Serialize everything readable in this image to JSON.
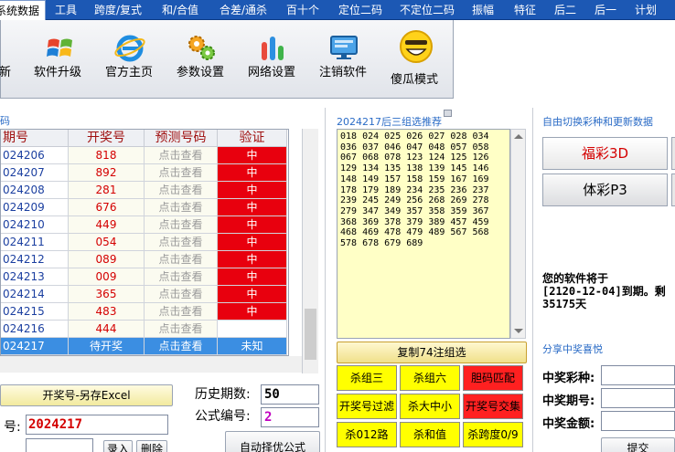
{
  "menu": {
    "items": [
      {
        "label": "系统数据",
        "active": true
      },
      {
        "label": "工具"
      },
      {
        "label": "跨度/复式"
      },
      {
        "label": "和/合值"
      },
      {
        "label": "合差/通杀"
      },
      {
        "label": "百十个"
      },
      {
        "label": "定位二码"
      },
      {
        "label": "不定位二码"
      },
      {
        "label": "振幅"
      },
      {
        "label": "特征"
      },
      {
        "label": "后二"
      },
      {
        "label": "后一"
      },
      {
        "label": "计划"
      }
    ]
  },
  "toolbar": {
    "buttons": [
      {
        "label": "新",
        "icon": "new-icon"
      },
      {
        "label": "软件升级",
        "icon": "windows-logo-icon"
      },
      {
        "label": "官方主页",
        "icon": "ie-browser-icon"
      },
      {
        "label": "参数设置",
        "icon": "gears-icon"
      },
      {
        "label": "网络设置",
        "icon": "bar-chart-icon"
      },
      {
        "label": "注销软件",
        "icon": "monitor-icon"
      },
      {
        "label": "傻瓜模式",
        "icon": "smiley-icon"
      }
    ]
  },
  "left": {
    "panel_header": "码",
    "columns": [
      "期号",
      "开奖号",
      "预测号码",
      "验证"
    ],
    "rows": [
      {
        "issue": "024206",
        "draw": "818",
        "pred": "点击查看",
        "ver": "中"
      },
      {
        "issue": "024207",
        "draw": "892",
        "pred": "点击查看",
        "ver": "中"
      },
      {
        "issue": "024208",
        "draw": "281",
        "pred": "点击查看",
        "ver": "中"
      },
      {
        "issue": "024209",
        "draw": "676",
        "pred": "点击查看",
        "ver": "中"
      },
      {
        "issue": "024210",
        "draw": "449",
        "pred": "点击查看",
        "ver": "中"
      },
      {
        "issue": "024211",
        "draw": "054",
        "pred": "点击查看",
        "ver": "中"
      },
      {
        "issue": "024212",
        "draw": "089",
        "pred": "点击查看",
        "ver": "中"
      },
      {
        "issue": "024213",
        "draw": "009",
        "pred": "点击查看",
        "ver": "中"
      },
      {
        "issue": "024214",
        "draw": "365",
        "pred": "点击查看",
        "ver": "中"
      },
      {
        "issue": "024215",
        "draw": "483",
        "pred": "点击查看",
        "ver": "中"
      },
      {
        "issue": "024216",
        "draw": "444",
        "pred": "点击查看",
        "ver": ""
      },
      {
        "issue": "024217",
        "draw": "待开奖",
        "pred": "点击查看",
        "ver": "未知",
        "selected": true
      }
    ],
    "save_button": "开奖号-另存Excel",
    "history_label": "历史期数:",
    "history_value": "50",
    "formula_label": "公式编号:",
    "formula_value": "2",
    "issue_label": "号:",
    "issue_value": "2024217",
    "enter_button": "录入",
    "delete_button": "删除",
    "auto_button": "自动择优公式"
  },
  "middle": {
    "title": "2024217后三组选推荐",
    "numbers_text": "018 024 025 026 027 028 034 036 037 046 047 048 057 058 067 068 078 123 124 125 126 129 134 135 138 139 145 146 148 149 157 158 159 167 169 178 179 189 234 235 236 237 239 245 249 256 268 269 278 279 347 349 357 358 359 367 368 369 378 379 389 457 459 468 469 478 479 489 567 568 578 678 679 689",
    "copy_button": "复制74注组选",
    "filters": [
      {
        "label": "杀组三",
        "color": "yellow"
      },
      {
        "label": "杀组六",
        "color": "yellow"
      },
      {
        "label": "胆码匹配",
        "color": "red"
      },
      {
        "label": "开奖号过滤",
        "color": "yellow"
      },
      {
        "label": "杀大中小",
        "color": "yellow"
      },
      {
        "label": "开奖号交集",
        "color": "red"
      },
      {
        "label": "杀012路",
        "color": "yellow"
      },
      {
        "label": "杀和值",
        "color": "yellow"
      },
      {
        "label": "杀跨度0/9",
        "color": "yellow"
      }
    ]
  },
  "right": {
    "title": "自由切换彩种和更新数据",
    "lottery_fucai": "福彩3D",
    "lottery_ticai": "体彩P3",
    "expire_line1": "您的软件将于",
    "expire_line2": "[2120-12-04]到期。剩",
    "expire_line3": "35175天",
    "share_title": "分享中奖喜悦",
    "share_type_label": "中奖彩种:",
    "share_issue_label": "中奖期号:",
    "share_amount_label": "中奖金额:",
    "submit_button": "提交"
  },
  "colors": {
    "menu_bg": "#1c58b4",
    "hit_red": "#e8000e",
    "filter_yellow": "#ffff00",
    "filter_red": "#ff2020",
    "recommend_bg": "#ffffc6"
  }
}
